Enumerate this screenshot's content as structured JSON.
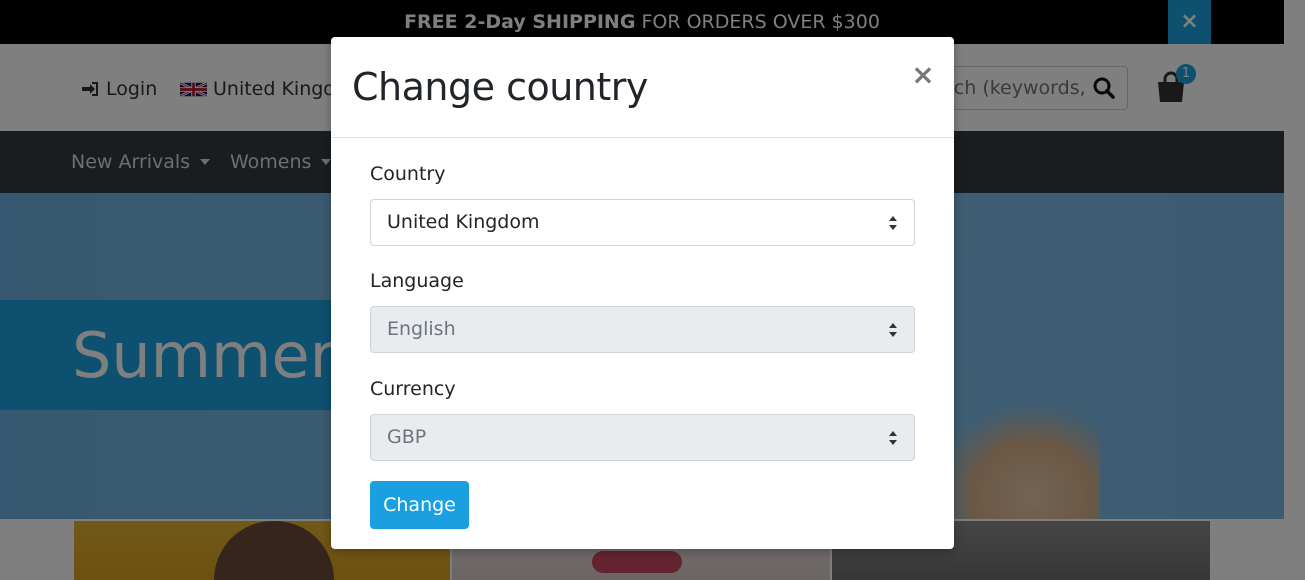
{
  "promo": {
    "bold_text": "FREE 2-Day SHIPPING",
    "rest_text": " FOR ORDERS OVER $300",
    "close_glyph": "×"
  },
  "header": {
    "login_label": "Login",
    "country_label": "United Kingdom",
    "search_placeholder": "Search (keywords,etc)",
    "cart_count": "1"
  },
  "nav": {
    "items": [
      {
        "label": "New Arrivals"
      },
      {
        "label": "Womens"
      }
    ]
  },
  "hero": {
    "title": "Summer Style"
  },
  "modal": {
    "title": "Change country",
    "close_glyph": "×",
    "country": {
      "label": "Country",
      "value": "United Kingdom"
    },
    "language": {
      "label": "Language",
      "value": "English"
    },
    "currency": {
      "label": "Currency",
      "value": "GBP"
    },
    "submit_label": "Change"
  },
  "colors": {
    "accent": "#1aa0e0",
    "nav_bg": "#343a40",
    "promo_bg": "#000000"
  },
  "icons": [
    "sign-in-icon",
    "uk-flag-icon",
    "search-icon",
    "shopping-bag-icon",
    "close-icon",
    "select-arrows-icon",
    "caret-down-icon"
  ]
}
